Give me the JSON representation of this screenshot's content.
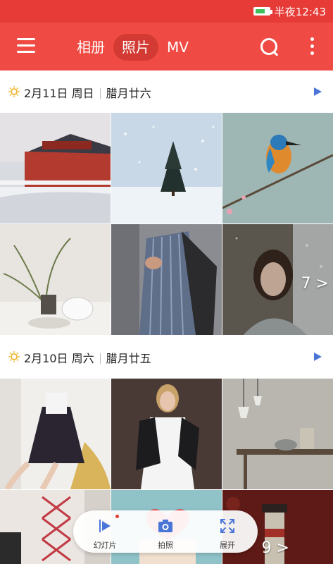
{
  "status_bar": {
    "time": "半夜12:43",
    "battery_level": 0.7,
    "background": "#e63b36"
  },
  "app_bar": {
    "background": "#ef4b44",
    "tabs": [
      {
        "label": "相册",
        "active": false
      },
      {
        "label": "照片",
        "active": true
      },
      {
        "label": "MV",
        "active": false
      }
    ],
    "icons": [
      "menu-icon",
      "search-icon",
      "more-vertical-icon"
    ]
  },
  "sections": [
    {
      "date": "2月11日 周日",
      "lunar": "腊月廿六",
      "photos": [
        {
          "subject": "palace-snow"
        },
        {
          "subject": "snow-tree"
        },
        {
          "subject": "kingfisher"
        },
        {
          "subject": "table-plants"
        },
        {
          "subject": "man-striped-shirt"
        },
        {
          "subject": "woman-snow",
          "more_count": "7 >"
        }
      ]
    },
    {
      "date": "2月10日 周六",
      "lunar": "腊月廿五",
      "photos": [
        {
          "subject": "woman-dress"
        },
        {
          "subject": "woman-leather-jacket"
        },
        {
          "subject": "interior-lamps"
        },
        {
          "subject": "lace-pattern"
        },
        {
          "subject": "heart-gift"
        },
        {
          "subject": "lighthouse",
          "more_count": "9 >"
        }
      ]
    }
  ],
  "bottom_actions": [
    {
      "label": "幻灯片",
      "icon": "slideshow-icon",
      "badge": true
    },
    {
      "label": "拍照",
      "icon": "camera-icon",
      "badge": false
    },
    {
      "label": "展开",
      "icon": "expand-icon",
      "badge": false
    }
  ],
  "colors": {
    "accent": "#ef4b44",
    "icon_blue": "#4a76d8",
    "sun": "#f0b52c"
  }
}
